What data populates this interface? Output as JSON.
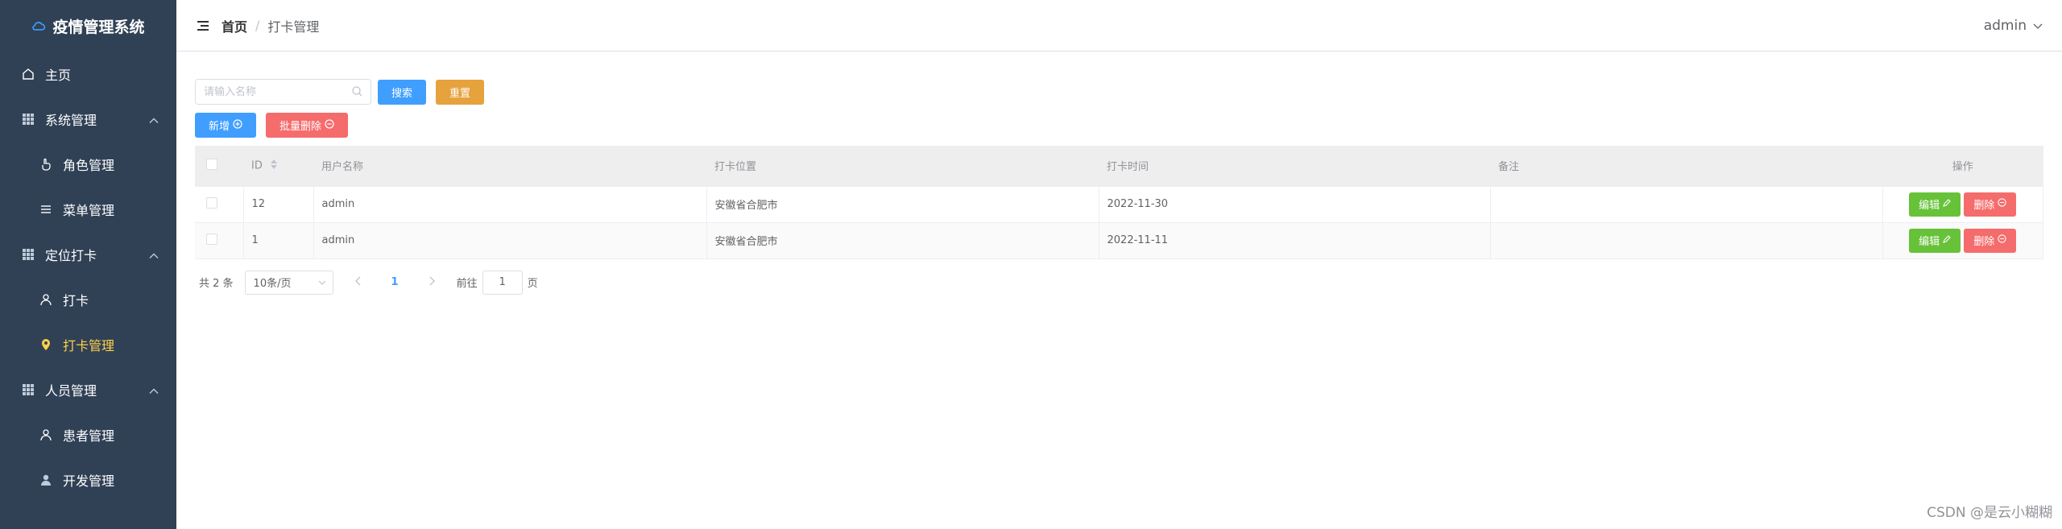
{
  "app": {
    "title": "疫情管理系统",
    "logo_icon": "cloud-icon"
  },
  "sidebar": {
    "items": [
      {
        "label": "主页",
        "icon": "home-icon"
      },
      {
        "label": "系统管理",
        "icon": "grid-icon"
      },
      {
        "label": "角色管理",
        "icon": "hand-icon"
      },
      {
        "label": "菜单管理",
        "icon": "list-icon"
      },
      {
        "label": "定位打卡",
        "icon": "grid-icon"
      },
      {
        "label": "打卡",
        "icon": "user-icon"
      },
      {
        "label": "打卡管理",
        "icon": "location-icon"
      },
      {
        "label": "人员管理",
        "icon": "grid-icon"
      },
      {
        "label": "患者管理",
        "icon": "user-icon"
      },
      {
        "label": "开发管理",
        "icon": "user-filled-icon"
      }
    ],
    "active_color": "#ffd04b",
    "bg_color": "#304156"
  },
  "header": {
    "breadcrumb": {
      "home": "首页",
      "separator": "/",
      "current": "打卡管理"
    },
    "user": "admin"
  },
  "toolbar": {
    "search_placeholder": "请输入名称",
    "search_label": "搜索",
    "reset_label": "重置",
    "add_label": "新增",
    "batch_delete_label": "批量删除"
  },
  "table": {
    "columns": [
      "ID",
      "用户名称",
      "打卡位置",
      "打卡时间",
      "备注",
      "操作"
    ],
    "rows": [
      {
        "id": "12",
        "user": "admin",
        "location": "安徽省合肥市",
        "time": "2022-11-30",
        "note": ""
      },
      {
        "id": "1",
        "user": "admin",
        "location": "安徽省合肥市",
        "time": "2022-11-11",
        "note": ""
      }
    ],
    "edit_label": "编辑",
    "delete_label": "删除"
  },
  "pagination": {
    "total_text": "共 2 条",
    "page_size": "10条/页",
    "current_page": "1",
    "goto_prefix": "前往",
    "goto_value": "1",
    "goto_suffix": "页"
  },
  "watermark": "CSDN @是云小糊糊"
}
